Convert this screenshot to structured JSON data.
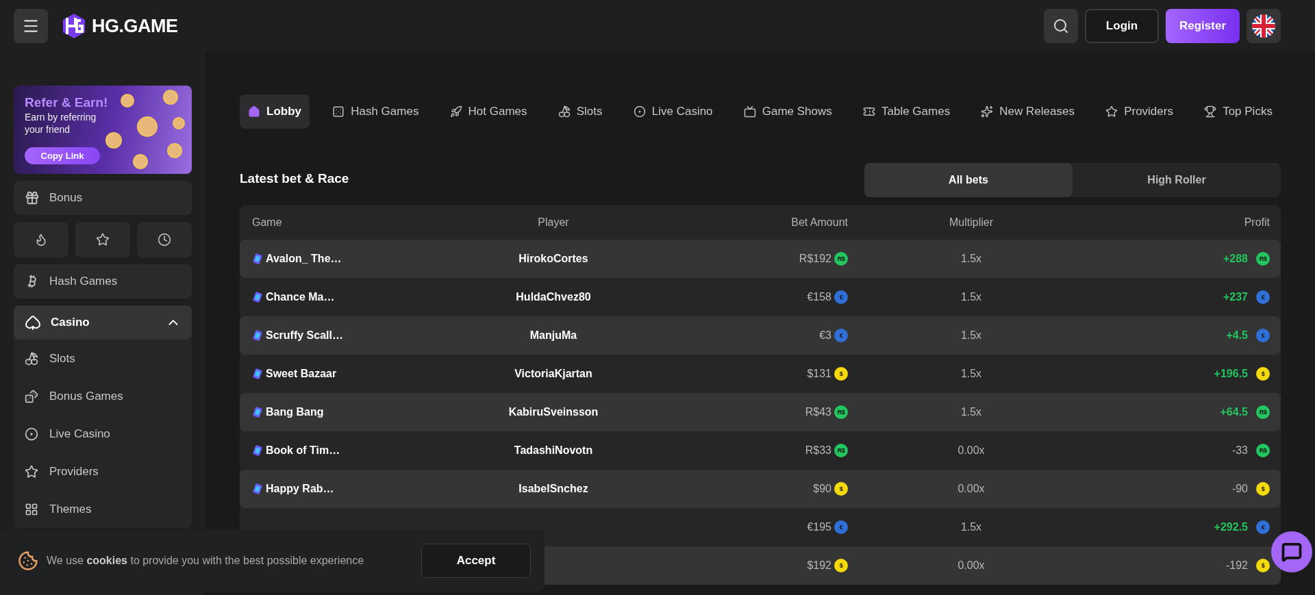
{
  "header": {
    "logo": "HG.GAME",
    "login": "Login",
    "register": "Register"
  },
  "sidebar": {
    "promo": {
      "title": "Refer & Earn!",
      "text": "Earn by referring your friend",
      "button": "Copy Link"
    },
    "bonus": "Bonus",
    "nav": [
      {
        "label": "Hash Games"
      },
      {
        "label": "Casino",
        "expanded": true,
        "children": [
          {
            "label": "Slots"
          },
          {
            "label": "Bonus Games"
          },
          {
            "label": "Live Casino"
          },
          {
            "label": "Providers"
          },
          {
            "label": "Themes"
          }
        ]
      }
    ]
  },
  "tabs": [
    {
      "label": "Lobby",
      "selected": true
    },
    {
      "label": "Hash Games",
      "selected": false
    },
    {
      "label": "Hot Games",
      "selected": false
    },
    {
      "label": "Slots",
      "selected": false
    },
    {
      "label": "Live Casino",
      "selected": false
    },
    {
      "label": "Game Shows",
      "selected": false
    },
    {
      "label": "Table Games",
      "selected": false
    },
    {
      "label": "New Releases",
      "selected": false
    },
    {
      "label": "Providers",
      "selected": false
    },
    {
      "label": "Top Picks",
      "selected": false
    }
  ],
  "bets": {
    "title": "Latest bet & Race",
    "filters": [
      {
        "label": "All bets",
        "selected": true
      },
      {
        "label": "High Roller",
        "selected": false
      }
    ],
    "columns": [
      "Game",
      "Player",
      "Bet Amount",
      "Multiplier",
      "Profit"
    ],
    "rows": [
      {
        "game": "Avalon_ The…",
        "player": "HirokoCortes",
        "bet": "R$192",
        "bet_coin": {
          "symbol": "R$",
          "color": "#22c55e"
        },
        "multiplier": "1.5x",
        "profit": "+288",
        "profit_coin": {
          "symbol": "R$",
          "color": "#22c55e"
        },
        "win": true
      },
      {
        "game": "Chance Ma…",
        "player": "HuldaChvez80",
        "bet": "€158",
        "bet_coin": {
          "symbol": "€",
          "color": "#2f6fd6"
        },
        "multiplier": "1.5x",
        "profit": "+237",
        "profit_coin": {
          "symbol": "€",
          "color": "#2f6fd6"
        },
        "win": true
      },
      {
        "game": "Scruffy Scall…",
        "player": "ManjuMa",
        "bet": "€3",
        "bet_coin": {
          "symbol": "€",
          "color": "#2f6fd6"
        },
        "multiplier": "1.5x",
        "profit": "+4.5",
        "profit_coin": {
          "symbol": "€",
          "color": "#2f6fd6"
        },
        "win": true
      },
      {
        "game": "Sweet Bazaar",
        "player": "VictoriaKjartan",
        "bet": "$131",
        "bet_coin": {
          "symbol": "$",
          "color": "#f5d90a"
        },
        "multiplier": "1.5x",
        "profit": "+196.5",
        "profit_coin": {
          "symbol": "$",
          "color": "#f5d90a"
        },
        "win": true
      },
      {
        "game": "Bang Bang",
        "player": "KabiruSveinsson",
        "bet": "R$43",
        "bet_coin": {
          "symbol": "R$",
          "color": "#22c55e"
        },
        "multiplier": "1.5x",
        "profit": "+64.5",
        "profit_coin": {
          "symbol": "R$",
          "color": "#22c55e"
        },
        "win": true
      },
      {
        "game": "Book of Tim…",
        "player": "TadashiNovotn",
        "bet": "R$33",
        "bet_coin": {
          "symbol": "R$",
          "color": "#22c55e"
        },
        "multiplier": "0.00x",
        "profit": "-33",
        "profit_coin": {
          "symbol": "R$",
          "color": "#22c55e"
        },
        "win": false
      },
      {
        "game": "Happy Rab…",
        "player": "IsabelSnchez",
        "bet": "$90",
        "bet_coin": {
          "symbol": "$",
          "color": "#f5d90a"
        },
        "multiplier": "0.00x",
        "profit": "-90",
        "profit_coin": {
          "symbol": "$",
          "color": "#f5d90a"
        },
        "win": false
      },
      {
        "bet": "€195",
        "bet_coin": {
          "symbol": "€",
          "color": "#2f6fd6"
        },
        "multiplier": "1.5x",
        "profit": "+292.5",
        "profit_coin": {
          "symbol": "€",
          "color": "#2f6fd6"
        },
        "win": true
      },
      {
        "bet": "$192",
        "bet_coin": {
          "symbol": "$",
          "color": "#f5d90a"
        },
        "multiplier": "0.00x",
        "profit": "-192",
        "profit_coin": {
          "symbol": "$",
          "color": "#f5d90a"
        },
        "win": false
      }
    ]
  },
  "cookie": {
    "text": "We use **cookies** to provide you with the best possible experience",
    "button": "Accept"
  }
}
